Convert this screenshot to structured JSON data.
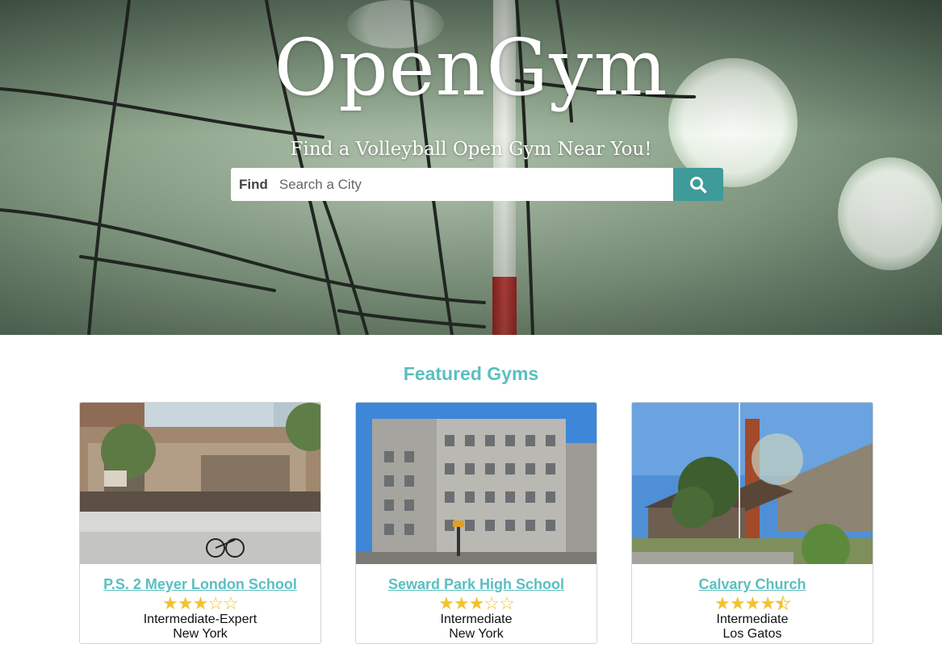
{
  "hero": {
    "logo": "OpenGym",
    "tagline": "Find a Volleyball Open Gym Near You!",
    "search": {
      "find_label": "Find",
      "placeholder": "Search a City",
      "button_icon": "search-icon"
    }
  },
  "featured": {
    "title": "Featured Gyms",
    "gyms": [
      {
        "name": "P.S. 2 Meyer London School",
        "rating": 3,
        "max_rating": 5,
        "level": "Intermediate-Expert",
        "city": "New York"
      },
      {
        "name": "Seward Park High School",
        "rating": 3,
        "max_rating": 5,
        "level": "Intermediate",
        "city": "New York"
      },
      {
        "name": "Calvary Church",
        "rating": 4.5,
        "max_rating": 5,
        "level": "Intermediate",
        "city": "Los Gatos"
      }
    ]
  },
  "colors": {
    "accent": "#5bbfc0",
    "search_button": "#3e9b99",
    "star": "#f2c230"
  }
}
